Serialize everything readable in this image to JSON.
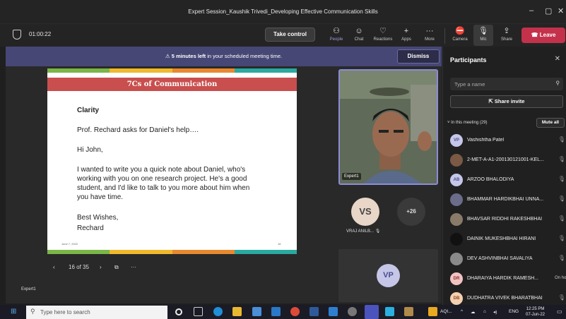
{
  "window": {
    "title": "Expert Session_Kaushik Trivedi_Developing Effective Communication Skills",
    "min_icon": "minimize-icon",
    "max_icon": "maximize-icon",
    "close_icon": "close-icon"
  },
  "toolbar": {
    "timer": "01:00:22",
    "take_control": "Take control",
    "people": "People",
    "chat": "Chat",
    "reactions": "Reactions",
    "apps": "Apps",
    "more": "More",
    "camera": "Camera",
    "mic": "Mic",
    "share": "Share",
    "leave": "Leave"
  },
  "banner": {
    "bold": "5 minutes left",
    "rest": "in your scheduled meeting time.",
    "dismiss": "Dismiss"
  },
  "slide": {
    "title": "7Cs of Communication",
    "heading": "Clarity",
    "line1": "Prof. Rechard asks for Daniel's help….",
    "line2": "Hi John,",
    "para": [
      "I wanted to write you a quick note about Daniel, who's",
      "working with you on one research project. He's a good",
      "student, and I'd like to talk to you more about him when",
      "you have time."
    ],
    "closing": "Best Wishes,",
    "signature": "Rechard",
    "date": "June 7, 2022",
    "page": "16"
  },
  "slide_nav": {
    "counter": "16 of 35",
    "more": "···"
  },
  "stage_label": "Expert1",
  "video": {
    "label": "Expert1"
  },
  "tiles": {
    "vs_initials": "VS",
    "vs_name": "VRAJ ANILB...",
    "overflow": "+26",
    "vp_initials": "VP"
  },
  "participants": {
    "title": "Participants",
    "search_placeholder": "Type a name",
    "share_invite": "Share invite",
    "in_meeting": "In this meeting (29)",
    "mute_all": "Mute all",
    "list": [
      {
        "initials": "VP",
        "name": "Vashishtha Patel",
        "color": "#c5c6e8",
        "tc": "#4b4c8a"
      },
      {
        "initials": "",
        "name": "2-MET-A-A1-200130121001-KEL...",
        "color": "#7a5a45",
        "tc": "#fff"
      },
      {
        "initials": "AB",
        "name": "ARZOO BHALODIYA",
        "color": "#c5c6e8",
        "tc": "#4b4c8a"
      },
      {
        "initials": "",
        "name": "BHAMMAR HARDIKBHAI UNNA...",
        "color": "#6b6b8a",
        "tc": "#fff"
      },
      {
        "initials": "",
        "name": "BHAVSAR RIDDHI RAKESHBHAI",
        "color": "#8a7a6a",
        "tc": "#fff"
      },
      {
        "initials": "",
        "name": "DAINIK MUKESHBHAI HIRANI",
        "color": "#111111",
        "tc": "#fff"
      },
      {
        "initials": "",
        "name": "DEV ASHVINBHAI SAVALIYA",
        "color": "#8a8a8a",
        "tc": "#fff"
      },
      {
        "initials": "DR",
        "name": "DHARAIYA HARDIK RAMESH...",
        "color": "#f2c3c3",
        "tc": "#8a2a2a",
        "hold": "On hold"
      },
      {
        "initials": "DB",
        "name": "DUDHATRA VIVEK BHARATBHAI",
        "color": "#f5d0b0",
        "tc": "#8a4a1a"
      }
    ]
  },
  "taskbar": {
    "search_placeholder": "Type here to search",
    "tray_label": "AQI...",
    "lang": "ENG",
    "time": "12:25 PM",
    "date": "07-Jun-22"
  },
  "colors": {
    "accent": "#8b8cd8",
    "leave": "#c4314b",
    "banner": "#464775",
    "slide_title": "#c84f4e"
  }
}
